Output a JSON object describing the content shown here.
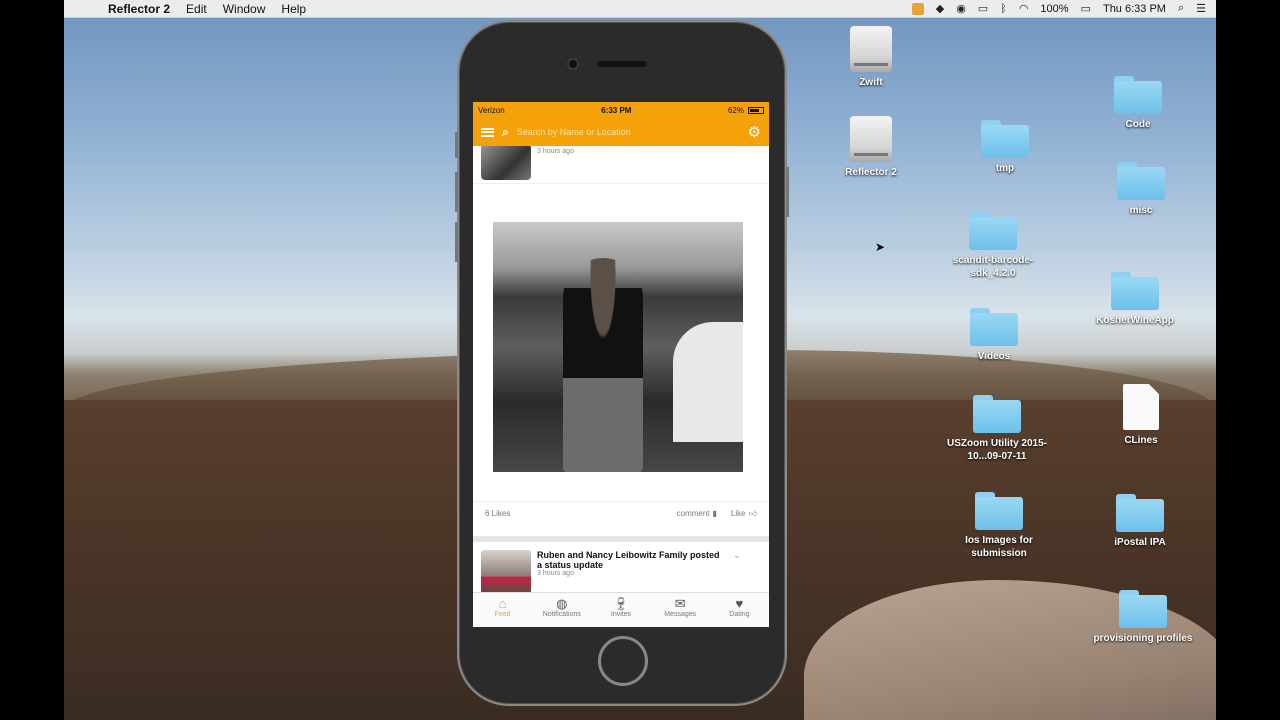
{
  "menubar": {
    "app_name": "Reflector 2",
    "menus": [
      "Edit",
      "Window",
      "Help"
    ],
    "battery": "100%",
    "clock": "Thu 6:33 PM"
  },
  "desktop": {
    "icons": [
      {
        "label": "Zwift",
        "type": "drive"
      },
      {
        "label": "Reflector 2",
        "type": "drive"
      },
      {
        "label": "tmp",
        "type": "folder"
      },
      {
        "label": "Code",
        "type": "folder"
      },
      {
        "label": "misc",
        "type": "folder"
      },
      {
        "label": "scandit-barcode-sdk_4.2.0",
        "type": "folder"
      },
      {
        "label": "KosherWineApp",
        "type": "folder"
      },
      {
        "label": "Videos",
        "type": "folder"
      },
      {
        "label": "USZoom Utility 2015-10...09-07-11",
        "type": "folder"
      },
      {
        "label": "CLines",
        "type": "document"
      },
      {
        "label": "Ios Images for submission",
        "type": "folder"
      },
      {
        "label": "iPostal IPA",
        "type": "folder"
      },
      {
        "label": "provisioning profiles",
        "type": "folder"
      }
    ]
  },
  "phone": {
    "status": {
      "carrier": "Verizon",
      "time": "6:33 PM",
      "battery": "62%"
    },
    "search": {
      "placeholder": "Search by Name or Location"
    },
    "feed": {
      "top_post_time": "3 hours ago",
      "likes": "6 Likes",
      "comment_label": "comment",
      "like_label": "Like",
      "post2": {
        "title": "Ruben and Nancy Leibowitz Family posted a status update",
        "time": "3 hours ago"
      }
    },
    "tabs": [
      {
        "label": "Feed",
        "icon": "home-icon",
        "active": true
      },
      {
        "label": "Notifications",
        "icon": "globe-icon",
        "active": false
      },
      {
        "label": "Invites",
        "icon": "wine-glass-icon",
        "active": false
      },
      {
        "label": "Messages",
        "icon": "envelope-icon",
        "active": false
      },
      {
        "label": "Dating",
        "icon": "heart-icon",
        "active": false
      }
    ],
    "accent_color": "#f5a20a"
  }
}
